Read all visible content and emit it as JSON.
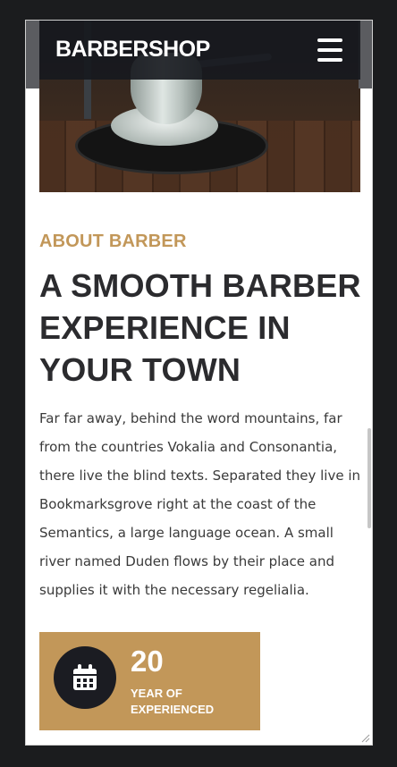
{
  "navbar": {
    "brand": "BARBERSHOP",
    "menu_icon": "hamburger-icon"
  },
  "hero": {
    "image": "barber-chair-photo"
  },
  "about": {
    "kicker": "ABOUT BARBER",
    "heading": "A SMOOTH BARBER EXPERIENCE IN YOUR TOWN",
    "body": "Far far away, behind the word mountains, far from the countries Vokalia and Consonantia, there live the blind texts. Separated they live in Bookmarksgrove right at the coast of the Semantics, a large language ocean. A small river named Duden flows by their place and supplies it with the necessary regelialia."
  },
  "stat": {
    "icon": "calendar-icon",
    "number": "20",
    "label": "YEAR OF EXPERIENCED"
  },
  "colors": {
    "accent": "#c29759",
    "dark": "#1b1c22",
    "heading": "#2b2b2e",
    "background": "#1b1c1e"
  }
}
